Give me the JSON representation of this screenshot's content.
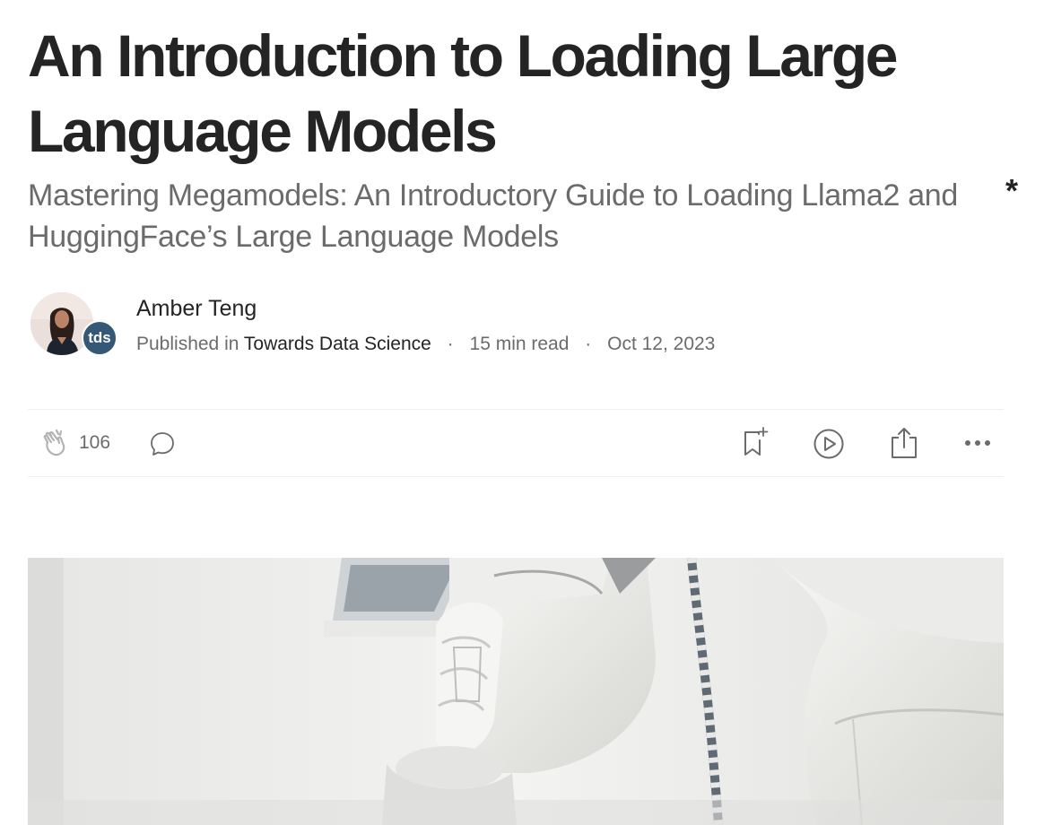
{
  "article": {
    "title": "An Introduction to Loading Large Language Models",
    "subtitle": "Mastering Megamodels: An Introductory Guide to Loading Llama2 and HuggingFace’s Large Language Models"
  },
  "author": {
    "name": "Amber Teng",
    "publication_badge": "tds"
  },
  "meta": {
    "published_in_label": "Published in",
    "publication": "Towards Data Science",
    "read_time": "15 min read",
    "date": "Oct 12, 2023",
    "separator": "·"
  },
  "actions": {
    "clap_count": "106"
  },
  "icons": {
    "clap": "clap-icon",
    "comment": "comment-icon",
    "bookmark": "bookmark-add-icon",
    "listen": "play-icon",
    "share": "share-icon",
    "more": "more-icon"
  },
  "colors": {
    "text_primary": "#242424",
    "text_secondary": "#6b6b6b",
    "badge": "#355876"
  }
}
